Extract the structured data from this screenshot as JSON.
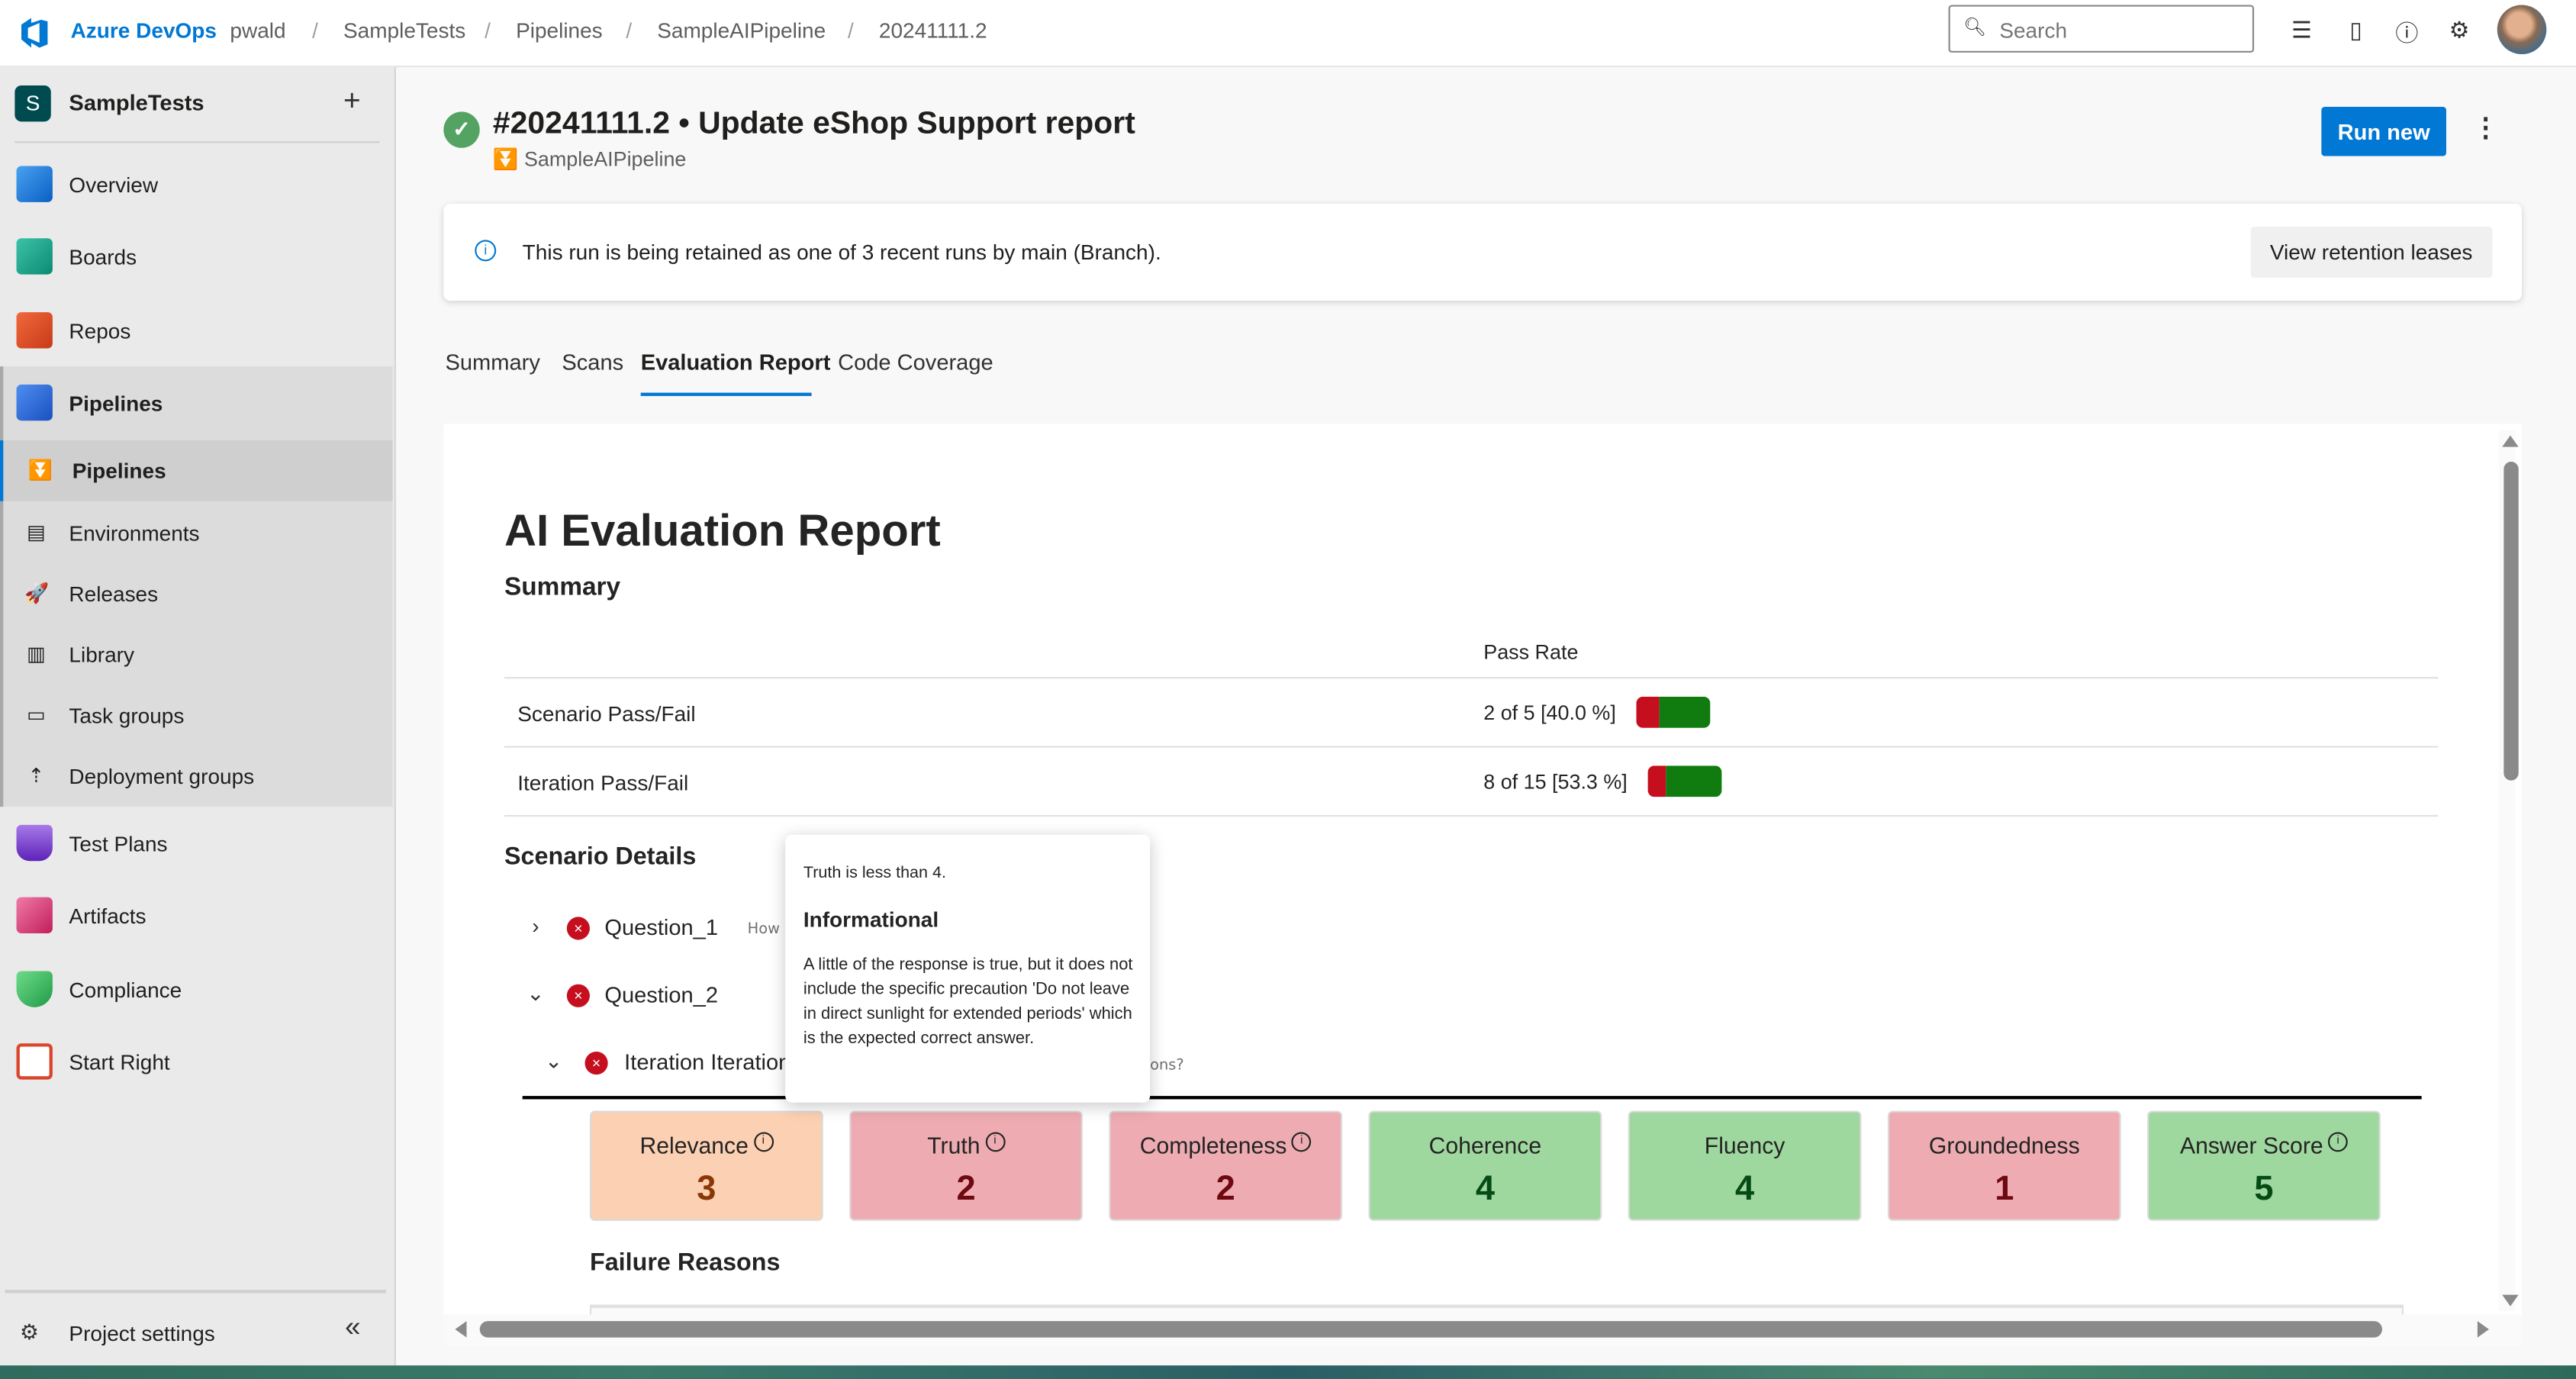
{
  "topbar": {
    "brand": "Azure DevOps",
    "breadcrumb": [
      "pwald",
      "SampleTests",
      "Pipelines",
      "SampleAIPipeline",
      "20241111.2"
    ],
    "search_placeholder": "Search",
    "icons": [
      "task-list-icon",
      "shopping-bag-icon",
      "help-icon",
      "user-settings-icon"
    ],
    "avatar_label": "User avatar"
  },
  "sidebar": {
    "project_initial": "S",
    "project_name": "SampleTests",
    "add_label": "+",
    "items": [
      {
        "label": "Overview",
        "icon": "overview-icon",
        "color": "#0078d4"
      },
      {
        "label": "Boards",
        "icon": "boards-icon",
        "color": "#009d8f"
      },
      {
        "label": "Repos",
        "icon": "repos-icon",
        "color": "#e0501e"
      },
      {
        "label": "Pipelines",
        "icon": "pipelines-icon",
        "color": "#2f6fd8"
      }
    ],
    "sub_items": [
      {
        "label": "Pipelines",
        "icon": "⏬",
        "selected": true
      },
      {
        "label": "Environments",
        "icon": "▤"
      },
      {
        "label": "Releases",
        "icon": "🚀"
      },
      {
        "label": "Library",
        "icon": "▥"
      },
      {
        "label": "Task groups",
        "icon": "▭"
      },
      {
        "label": "Deployment groups",
        "icon": "⇡"
      }
    ],
    "items_after": [
      {
        "label": "Test Plans",
        "icon": "test-plans-icon",
        "color": "#773adc"
      },
      {
        "label": "Artifacts",
        "icon": "artifacts-icon",
        "color": "#d6336c"
      },
      {
        "label": "Compliance",
        "icon": "compliance-icon",
        "color": "#3cb95a"
      },
      {
        "label": "Start Right",
        "icon": "start-right-icon",
        "color": "#d9462b"
      }
    ],
    "project_settings": "Project settings",
    "collapse_label": "«"
  },
  "run": {
    "status": "succeeded",
    "title": "#20241111.2 • Update eShop Support report",
    "pipeline": "SampleAIPipeline",
    "run_new": "Run new",
    "more": "⋮"
  },
  "banner": {
    "message": "This run is being retained as one of 3 recent runs by main (Branch).",
    "button": "View retention leases"
  },
  "tabs": [
    {
      "label": "Summary",
      "active": false
    },
    {
      "label": "Scans",
      "active": false
    },
    {
      "label": "Evaluation Report",
      "active": true
    },
    {
      "label": "Code Coverage",
      "active": false
    }
  ],
  "report": {
    "title": "AI Evaluation Report",
    "summary_heading": "Summary",
    "pass_rate_header": "Pass Rate",
    "rows": [
      {
        "label": "Scenario Pass/Fail",
        "value": "2 of 5 [40.0 %]",
        "passed": 2,
        "total": 5,
        "pass_fraction": 0.4
      },
      {
        "label": "Iteration Pass/Fail",
        "value": "8 of 15 [53.3 %]",
        "passed": 8,
        "total": 15,
        "pass_fraction": 0.533
      }
    ],
    "colors": {
      "fail": "#c50f1f",
      "pass": "#107c10"
    },
    "scenario_heading": "Scenario Details",
    "scenarios": [
      {
        "name": "Question_1",
        "expanded": false,
        "status": "failed",
        "hint": "How"
      },
      {
        "name": "Question_2",
        "expanded": true,
        "status": "failed"
      }
    ],
    "iteration": {
      "label": "Iteration Iteration",
      "status": "failed",
      "hint_tail": "ons?",
      "expanded": true
    },
    "metrics": [
      {
        "name": "Relevance",
        "value": "3",
        "info": true,
        "level": "warning"
      },
      {
        "name": "Truth",
        "value": "2",
        "info": true,
        "level": "fail"
      },
      {
        "name": "Completeness",
        "value": "2",
        "info": true,
        "level": "fail"
      },
      {
        "name": "Coherence",
        "value": "4",
        "info": false,
        "level": "pass"
      },
      {
        "name": "Fluency",
        "value": "4",
        "info": false,
        "level": "pass"
      },
      {
        "name": "Groundedness",
        "value": "1",
        "info": false,
        "level": "fail"
      },
      {
        "name": "Answer Score",
        "value": "5",
        "info": true,
        "level": "pass"
      }
    ],
    "failure_heading": "Failure Reasons"
  },
  "tooltip": {
    "line1": "Truth is less than 4.",
    "heading": "Informational",
    "body": "A little of the response is true, but it does not include the specific precaution 'Do not leave in direct sunlight for extended periods' which is the expected correct answer."
  }
}
